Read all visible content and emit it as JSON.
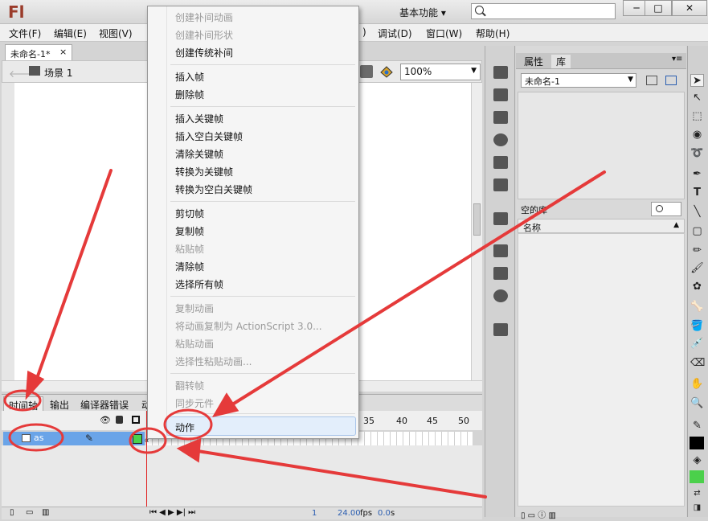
{
  "app": {
    "logo": "Fl",
    "workspace": "基本功能"
  },
  "window_controls": {
    "minimize": "─",
    "maximize": "□",
    "close": "✕"
  },
  "menubar": [
    {
      "label": "文件(F)"
    },
    {
      "label": "编辑(E)"
    },
    {
      "label": "视图(V)"
    },
    {
      "label": ")"
    },
    {
      "label": "调试(D)"
    },
    {
      "label": "窗口(W)"
    },
    {
      "label": "帮助(H)"
    }
  ],
  "document": {
    "tab": "未命名-1*",
    "close": "×",
    "scene": "场景 1",
    "zoom": "100%"
  },
  "timeline": {
    "tabs": [
      "时间轴",
      "输出",
      "编译器错误",
      "动"
    ],
    "frame_numbers": [
      "35",
      "40",
      "45",
      "50"
    ],
    "layer_name": "as",
    "footer": {
      "frame": "1",
      "fps": "24.00",
      "fps_unit": "fps",
      "time": "0.0",
      "time_unit": "s"
    }
  },
  "right_panel": {
    "tabs": [
      "属性",
      "库"
    ],
    "library_select": "未命名-1",
    "empty_label": "空的库",
    "column_name": "名称"
  },
  "context_menu": [
    {
      "label": "创建补间动画",
      "enabled": false
    },
    {
      "label": "创建补间形状",
      "enabled": false
    },
    {
      "label": "创建传统补间",
      "enabled": true
    },
    {
      "label": "插入帧",
      "enabled": true
    },
    {
      "label": "删除帧",
      "enabled": true
    },
    {
      "label": "插入关键帧",
      "enabled": true
    },
    {
      "label": "插入空白关键帧",
      "enabled": true
    },
    {
      "label": "清除关键帧",
      "enabled": true
    },
    {
      "label": "转换为关键帧",
      "enabled": true
    },
    {
      "label": "转换为空白关键帧",
      "enabled": true
    },
    {
      "label": "剪切帧",
      "enabled": true
    },
    {
      "label": "复制帧",
      "enabled": true
    },
    {
      "label": "粘贴帧",
      "enabled": false
    },
    {
      "label": "清除帧",
      "enabled": true
    },
    {
      "label": "选择所有帧",
      "enabled": true
    },
    {
      "label": "复制动画",
      "enabled": false
    },
    {
      "label": "将动画复制为 ActionScript 3.0...",
      "enabled": false
    },
    {
      "label": "粘贴动画",
      "enabled": false
    },
    {
      "label": "选择性粘贴动画...",
      "enabled": false
    },
    {
      "label": "翻转帧",
      "enabled": false
    },
    {
      "label": "同步元件",
      "enabled": false
    },
    {
      "label": "动作",
      "enabled": true
    }
  ],
  "annotation_color": "#e53a3a",
  "keyframe_color": "#4bd04b",
  "layer_highlight_color": "#6aa4e8"
}
